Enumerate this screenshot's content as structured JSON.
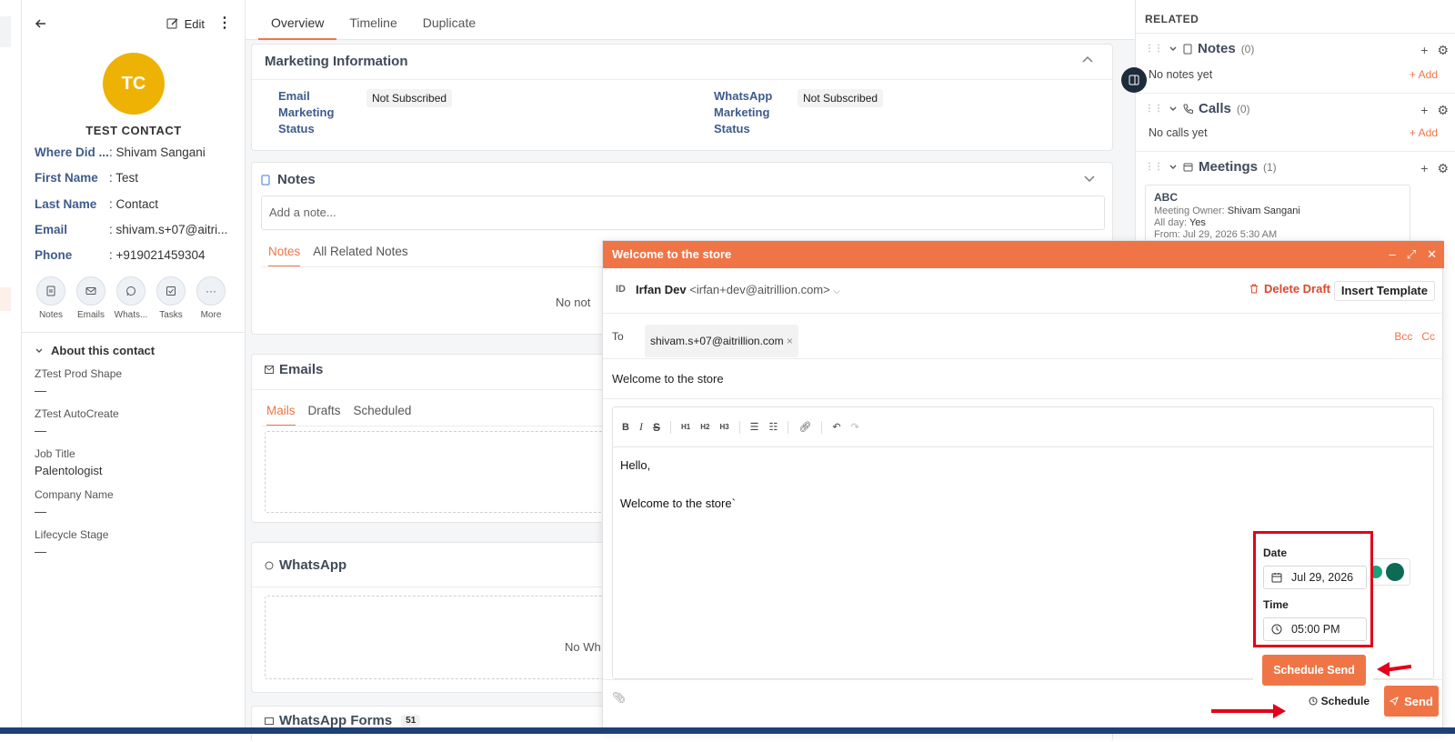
{
  "left": {
    "topbar": {
      "edit_label": "Edit"
    },
    "avatar_initials": "TC",
    "contact_name": "TEST CONTACT",
    "fields": [
      {
        "k": "Where Did ...",
        "v": ": Shivam Sangani"
      },
      {
        "k": "First Name",
        "v": ": Test"
      },
      {
        "k": "Last Name",
        "v": ": Contact"
      },
      {
        "k": "Email",
        "v": ": shivam.s+07@aitri..."
      },
      {
        "k": "Phone",
        "v": ": +919021459304"
      }
    ],
    "actions": [
      "Notes",
      "Emails",
      "Whats...",
      "Tasks",
      "More"
    ],
    "about_title": "About this contact",
    "props": [
      {
        "k": "ZTest Prod Shape",
        "v": "—"
      },
      {
        "k": "ZTest AutoCreate",
        "v": "—"
      },
      {
        "k": "Job Title",
        "v": "Palentologist"
      },
      {
        "k": "Company Name",
        "v": "—"
      },
      {
        "k": "Lifecycle Stage",
        "v": "—"
      }
    ]
  },
  "center": {
    "tabs": [
      "Overview",
      "Timeline",
      "Duplicate"
    ],
    "marketing": {
      "title": "Marketing Information",
      "email_label_1": "Email",
      "email_label_2": "Marketing",
      "email_label_3": "Status",
      "email_value": "Not Subscribed",
      "wa_label_1": "WhatsApp",
      "wa_label_2": "Marketing",
      "wa_label_3": "Status",
      "wa_value": "Not Subscribed"
    },
    "notes": {
      "title": "Notes",
      "placeholder": "Add a note...",
      "tab1": "Notes",
      "tab2": "All Related Notes",
      "empty": "No not"
    },
    "emails": {
      "title": "Emails",
      "tab1": "Mails",
      "tab2": "Drafts",
      "tab3": "Scheduled"
    },
    "whatsapp": {
      "title": "WhatsApp",
      "empty": "No Wh"
    },
    "whatsapp_forms": {
      "title": "WhatsApp Forms",
      "count": "51"
    }
  },
  "right": {
    "related": "RELATED",
    "notes": {
      "title": "Notes",
      "count": "(0)",
      "empty": "No notes yet",
      "add": "+ Add"
    },
    "calls": {
      "title": "Calls",
      "count": "(0)",
      "empty": "No calls yet",
      "add": "+ Add"
    },
    "meetings": {
      "title": "Meetings",
      "count": "(1)",
      "item_title": "ABC",
      "owner_label": "Meeting Owner:",
      "owner": "Shivam Sangani",
      "allday_label": "All day:",
      "allday": "Yes",
      "from_partial": "From: Jul 29, 2026 5:30 AM"
    }
  },
  "compose": {
    "title": "Welcome to the store",
    "from_prefix": "ID",
    "from_name": "Irfan Dev",
    "from_email": "<irfan+dev@aitrillion.com>",
    "delete_draft": "Delete Draft",
    "insert_template": "Insert Template",
    "to_label": "To",
    "to_chip": "shivam.s+07@aitrillion.com",
    "bcc": "Bcc",
    "cc": "Cc",
    "subject": "Welcome to the store",
    "body_line1": "Hello,",
    "body_line2": "Welcome to the store`",
    "toolbar": {
      "h1": "H1",
      "h2": "H2",
      "h3": "H3"
    },
    "schedule": {
      "date_label": "Date",
      "date_value": "Jul 29, 2026",
      "time_label": "Time",
      "time_value": "05:00 PM",
      "button": "Schedule Send"
    },
    "schedule_link": "Schedule",
    "send": "Send"
  }
}
